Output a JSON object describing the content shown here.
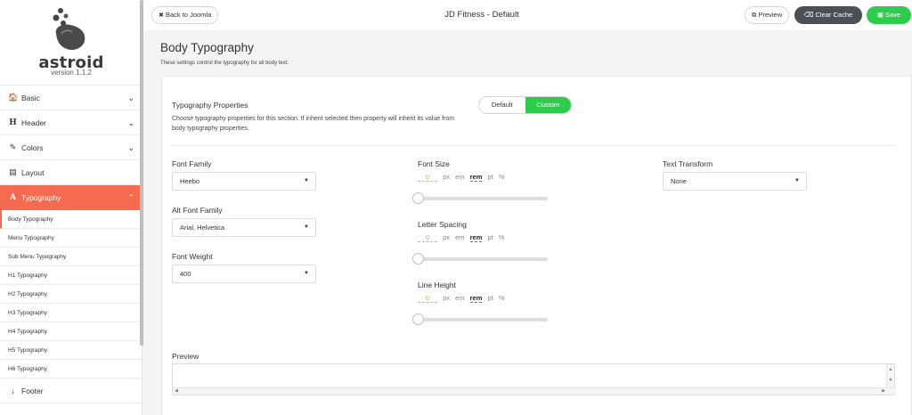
{
  "brand": {
    "name": "astroid",
    "version": "version 1.1.2"
  },
  "sidebar": {
    "items": [
      {
        "label": "Basic",
        "icon": "home-icon",
        "glyph": "🏠",
        "chevron": "⌄"
      },
      {
        "label": "Header",
        "icon": "header-icon",
        "glyph": "H",
        "chevron": "⌄"
      },
      {
        "label": "Colors",
        "icon": "brush-icon",
        "glyph": "✎",
        "chevron": "⌄"
      },
      {
        "label": "Layout",
        "icon": "layout-icon",
        "glyph": "▤",
        "chevron": ""
      },
      {
        "label": "Typography",
        "icon": "font-icon",
        "glyph": "A",
        "chevron": "⌃"
      }
    ],
    "sub_items": [
      "Body Typography",
      "Menu Typography",
      "Sub Menu Typography",
      "H1 Typography",
      "H2 Typography",
      "H3 Typography",
      "H4 Typography",
      "H5 Typography",
      "H6 Typography"
    ],
    "footer_item": {
      "label": "Footer",
      "icon": "arrow-down-icon",
      "glyph": "↓"
    }
  },
  "topbar": {
    "back_label": "Back to Joomla",
    "title": "JD Fitness - Default",
    "preview_label": "Preview",
    "clear_cache_label": "Clear Cache",
    "save_label": "Save"
  },
  "section": {
    "title": "Body Typography",
    "description": "These settings control the typography for all body text."
  },
  "properties": {
    "label": "Typography Properties",
    "description": "Choose typography properties for this section. If inherit selected then property will inherit its value from body typography properties.",
    "toggle_default": "Default",
    "toggle_custom": "Custom",
    "selected": "Custom"
  },
  "fields": {
    "font_family": {
      "label": "Font Family",
      "value": "Heebo"
    },
    "alt_font_family": {
      "label": "Alt Font Family",
      "value": "Arial, Helvetica"
    },
    "font_weight": {
      "label": "Font Weight",
      "value": "400"
    },
    "text_transform": {
      "label": "Text Transform",
      "value": "None"
    },
    "font_size": {
      "label": "Font Size",
      "value": "0",
      "units": [
        "px",
        "em",
        "rem",
        "pt",
        "%"
      ],
      "selected_unit": "rem",
      "slider_fraction": 0
    },
    "letter_spacing": {
      "label": "Letter Spacing",
      "value": "0",
      "units": [
        "px",
        "em",
        "rem",
        "pt",
        "%"
      ],
      "selected_unit": "rem",
      "slider_fraction": 0
    },
    "line_height": {
      "label": "Line Height",
      "value": "0",
      "units": [
        "px",
        "em",
        "rem",
        "pt",
        "%"
      ],
      "selected_unit": "rem",
      "slider_fraction": 0
    }
  },
  "preview": {
    "label": "Preview",
    "text": ""
  },
  "colors": {
    "accent": "#f66b4f",
    "success": "#2ecc4c",
    "dark_button": "#4a4f58"
  }
}
